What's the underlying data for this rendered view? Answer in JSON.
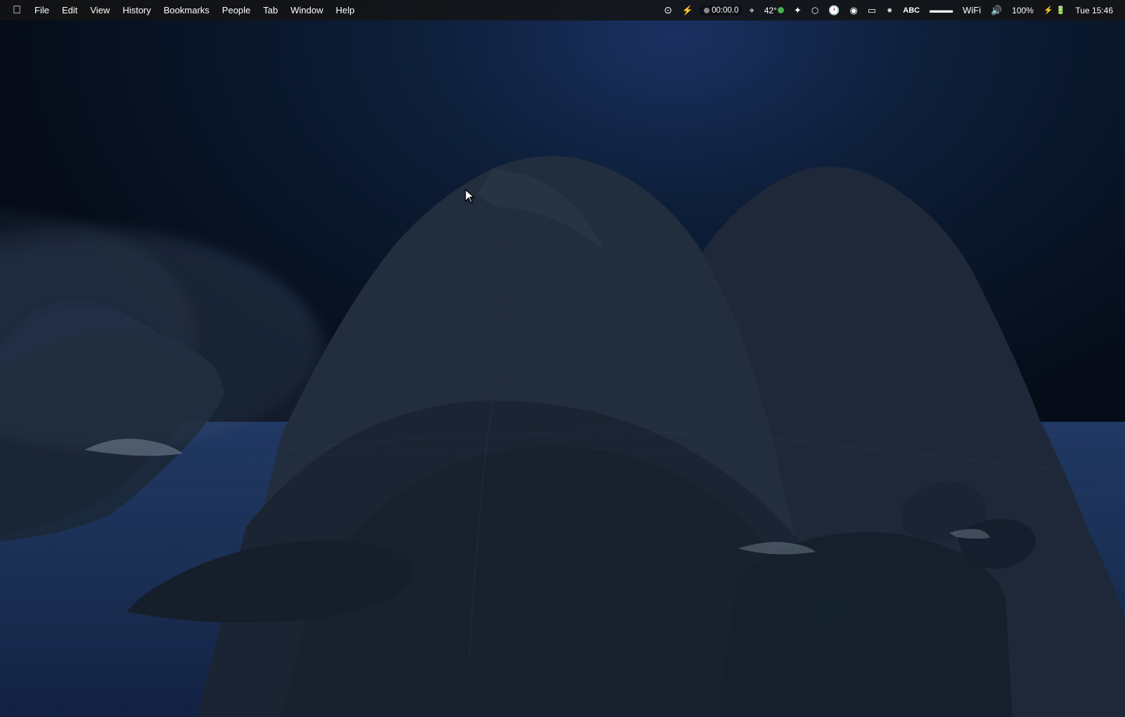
{
  "menubar": {
    "apple_symbol": "⌘",
    "menus": [
      {
        "id": "file",
        "label": "File"
      },
      {
        "id": "edit",
        "label": "Edit"
      },
      {
        "id": "view",
        "label": "View"
      },
      {
        "id": "history",
        "label": "History"
      },
      {
        "id": "bookmarks",
        "label": "Bookmarks"
      },
      {
        "id": "people",
        "label": "People"
      },
      {
        "id": "tab",
        "label": "Tab"
      },
      {
        "id": "window",
        "label": "Window"
      },
      {
        "id": "help",
        "label": "Help"
      }
    ]
  },
  "statusbar": {
    "timer": "00:00.0",
    "temperature": "42°",
    "wifi_strength": "strong",
    "volume_level": "medium",
    "brightness": "100%",
    "battery": "charging",
    "datetime": "Tue 15:46"
  },
  "desktop": {
    "background": "macOS Catalina night island"
  }
}
